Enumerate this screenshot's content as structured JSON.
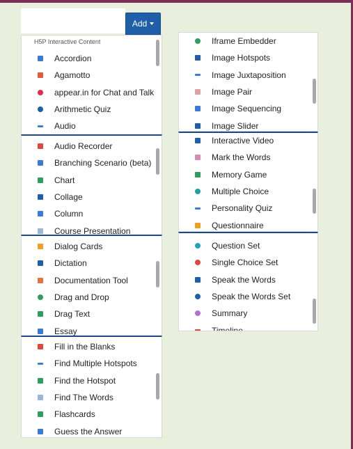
{
  "add_button": {
    "label": "Add"
  },
  "list_header": "H5P Interactive Content",
  "panels": [
    {
      "items": [
        {
          "label": "Accordion",
          "color": "#3a7bd5"
        },
        {
          "label": "Agamotto",
          "color": "#e05a3b"
        },
        {
          "label": "appear.in for Chat and Talk",
          "color": "#d9304f"
        },
        {
          "label": "Arithmetic Quiz",
          "color": "#1f5ea8"
        },
        {
          "label": "Audio",
          "color": "#3a7bd5"
        }
      ]
    },
    {
      "items": [
        {
          "label": "Audio Recorder",
          "color": "#e0463b"
        },
        {
          "label": "Branching Scenario (beta)",
          "color": "#3a7bd5"
        },
        {
          "label": "Chart",
          "color": "#2e9e5b"
        },
        {
          "label": "Collage",
          "color": "#1f5ea8"
        },
        {
          "label": "Column",
          "color": "#3a7bd5"
        },
        {
          "label": "Course Presentation",
          "color": "#9ab6d8"
        }
      ]
    },
    {
      "items": [
        {
          "label": "Dialog Cards",
          "color": "#f0a020"
        },
        {
          "label": "Dictation",
          "color": "#1f5ea8"
        },
        {
          "label": "Documentation Tool",
          "color": "#e0763b"
        },
        {
          "label": "Drag and Drop",
          "color": "#2e9e5b"
        },
        {
          "label": "Drag Text",
          "color": "#2e9e5b"
        },
        {
          "label": "Essay",
          "color": "#3a7bd5"
        }
      ]
    },
    {
      "items": [
        {
          "label": "Fill in the Blanks",
          "color": "#e0463b"
        },
        {
          "label": "Find Multiple Hotspots",
          "color": "#3a7bd5"
        },
        {
          "label": "Find the Hotspot",
          "color": "#2e9e5b"
        },
        {
          "label": "Find The Words",
          "color": "#9ab6d8"
        },
        {
          "label": "Flashcards",
          "color": "#2e9e5b"
        },
        {
          "label": "Guess the Answer",
          "color": "#3a7bd5"
        }
      ]
    },
    {
      "items": [
        {
          "label": "Iframe Embedder",
          "color": "#2e9e5b"
        },
        {
          "label": "Image Hotspots",
          "color": "#1f5ea8"
        },
        {
          "label": "Image Juxtaposition",
          "color": "#3a7bd5"
        },
        {
          "label": "Image Pair",
          "color": "#e0a0a0"
        },
        {
          "label": "Image Sequencing",
          "color": "#3a7bd5"
        },
        {
          "label": "Image Slider",
          "color": "#1f5ea8"
        }
      ]
    },
    {
      "items": [
        {
          "label": "Interactive Video",
          "color": "#1f5ea8"
        },
        {
          "label": "Mark the Words",
          "color": "#d98ab0"
        },
        {
          "label": "Memory Game",
          "color": "#2e9e5b"
        },
        {
          "label": "Multiple Choice",
          "color": "#20a0a0"
        },
        {
          "label": "Personality Quiz",
          "color": "#3a7bd5"
        },
        {
          "label": "Questionnaire",
          "color": "#f0a020"
        }
      ]
    },
    {
      "items": [
        {
          "label": "Question Set",
          "color": "#20a0c0"
        },
        {
          "label": "Single Choice Set",
          "color": "#e0463b"
        },
        {
          "label": "Speak the Words",
          "color": "#1f5ea8"
        },
        {
          "label": "Speak the Words Set",
          "color": "#1f5ea8"
        },
        {
          "label": "Summary",
          "color": "#b070d0"
        },
        {
          "label": "Timeline",
          "color": "#e0463b"
        }
      ]
    }
  ]
}
